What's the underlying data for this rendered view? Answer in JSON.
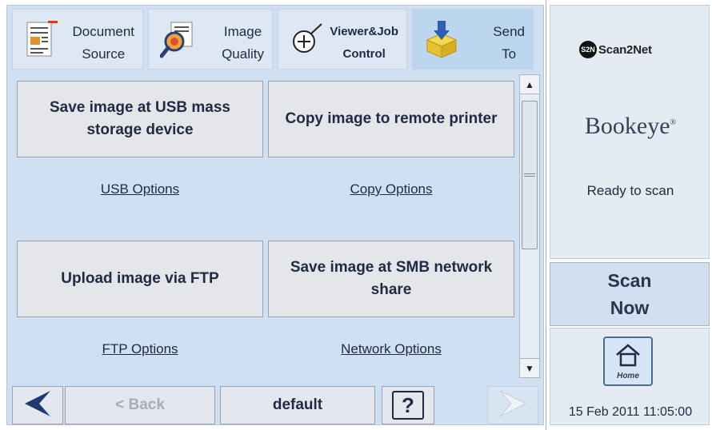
{
  "tabs": [
    {
      "line1": "Document",
      "line2": "Source",
      "icon": "document-icon"
    },
    {
      "line1": "Image",
      "line2": "Quality",
      "icon": "magnifier-icon"
    },
    {
      "line1": "Viewer&Job",
      "line2": "Control",
      "icon": "zoom-out-icon"
    },
    {
      "line1": "Send",
      "line2": "To",
      "icon": "send-box-icon"
    }
  ],
  "actions": [
    {
      "label": "Save image at USB mass storage device",
      "link": "USB Options"
    },
    {
      "label": "Copy image to remote printer",
      "link": "Copy Options"
    },
    {
      "label": "Upload image via FTP",
      "link": "FTP Options"
    },
    {
      "label": "Save image at SMB network share",
      "link": "Network Options"
    }
  ],
  "bottom": {
    "back_label": "< Back",
    "default_label": "default",
    "help_label": "?"
  },
  "side": {
    "brand_logo": "Scan2Net",
    "brand_logo_mark": "S2N",
    "product_logo": "Bookeye",
    "status": "Ready to scan",
    "scan_button_line1": "Scan",
    "scan_button_line2": "Now",
    "home_label": "Home",
    "datetime": "15 Feb 2011 11:05:00"
  },
  "colors": {
    "panel_bg": "#cfe0f2",
    "active_tab": "#bcd6ef",
    "nav_arrow": "#1f3a70"
  }
}
